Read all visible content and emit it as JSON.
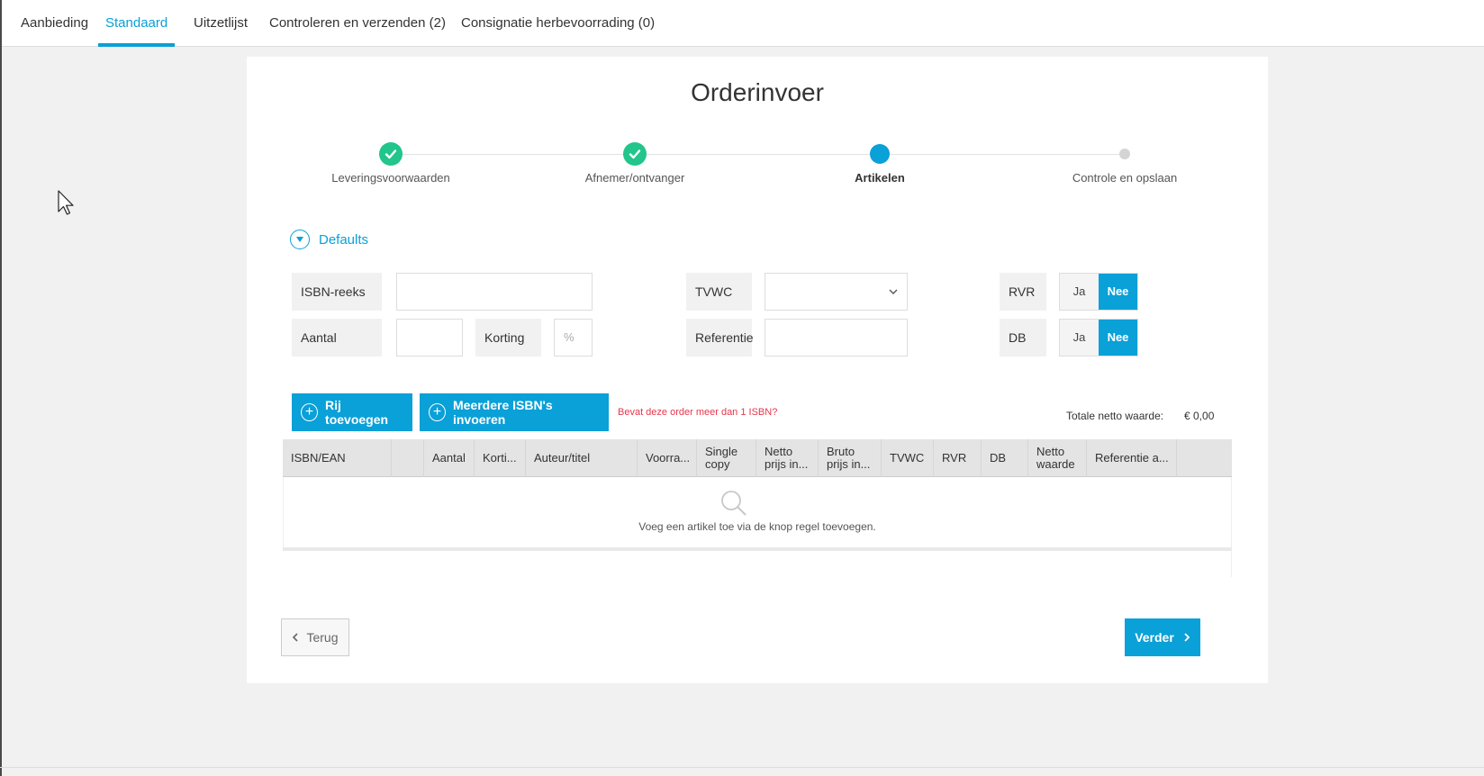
{
  "nav": {
    "tabs": [
      {
        "label": "Aanbieding"
      },
      {
        "label": "Standaard"
      },
      {
        "label": "Uitzetlijst"
      },
      {
        "label": "Controleren en verzenden (2)"
      },
      {
        "label": "Consignatie herbevoorrading (0)"
      }
    ],
    "active_tab": "Standaard"
  },
  "page": {
    "title": "Orderinvoer"
  },
  "steps": [
    {
      "label": "Leveringsvoorwaarden",
      "status": "done"
    },
    {
      "label": "Afnemer/ontvanger",
      "status": "done"
    },
    {
      "label": "Artikelen",
      "status": "current"
    },
    {
      "label": "Controle en opslaan",
      "status": "todo"
    }
  ],
  "defaults": {
    "toggle_label": "Defaults",
    "isbn_reeks": {
      "label": "ISBN-reeks",
      "value": ""
    },
    "aantal": {
      "label": "Aantal",
      "value": ""
    },
    "korting": {
      "label": "Korting",
      "placeholder": "%"
    },
    "tvwc": {
      "label": "TVWC",
      "value": ""
    },
    "referentie": {
      "label": "Referentie",
      "value": ""
    },
    "rvr": {
      "label": "RVR",
      "yes": "Ja",
      "no": "Nee",
      "selected": "Nee"
    },
    "db": {
      "label": "DB",
      "yes": "Ja",
      "no": "Nee",
      "selected": "Nee"
    }
  },
  "actions": {
    "add_row": "Rij toevoegen",
    "multi_isbn": "Meerdere ISBN's invoeren",
    "warning": "Bevat deze order meer dan 1 ISBN?",
    "total_label": "Totale netto waarde:",
    "total_value": "€ 0,00"
  },
  "table": {
    "columns": [
      {
        "line1": "ISBN/EAN",
        "line2": ""
      },
      {
        "line1": "",
        "line2": ""
      },
      {
        "line1": "Aantal",
        "line2": ""
      },
      {
        "line1": "Korti...",
        "line2": ""
      },
      {
        "line1": "Auteur/titel",
        "line2": ""
      },
      {
        "line1": "Voorra...",
        "line2": ""
      },
      {
        "line1": "Single",
        "line2": "copy"
      },
      {
        "line1": "Netto",
        "line2": "prijs in..."
      },
      {
        "line1": "Bruto",
        "line2": "prijs in..."
      },
      {
        "line1": "TVWC",
        "line2": ""
      },
      {
        "line1": "RVR",
        "line2": ""
      },
      {
        "line1": "DB",
        "line2": ""
      },
      {
        "line1": "Netto",
        "line2": "waarde"
      },
      {
        "line1": "Referentie a...",
        "line2": ""
      },
      {
        "line1": "",
        "line2": ""
      }
    ],
    "empty_text": "Voeg een artikel toe via de knop regel toevoegen."
  },
  "footer": {
    "back": "Terug",
    "next": "Verder"
  },
  "colors": {
    "accent": "#0aa0d8",
    "success": "#22c58b",
    "warning": "#e8364b"
  }
}
